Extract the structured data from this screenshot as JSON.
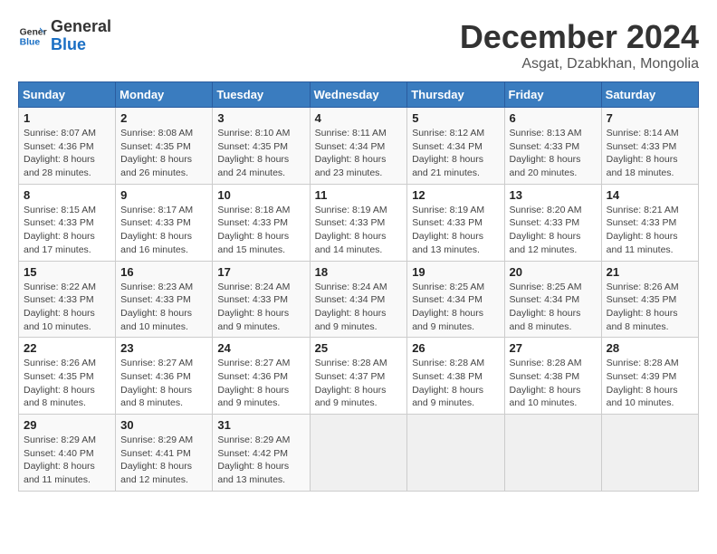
{
  "logo": {
    "line1": "General",
    "line2": "Blue"
  },
  "title": "December 2024",
  "subtitle": "Asgat, Dzabkhan, Mongolia",
  "days_of_week": [
    "Sunday",
    "Monday",
    "Tuesday",
    "Wednesday",
    "Thursday",
    "Friday",
    "Saturday"
  ],
  "weeks": [
    [
      {
        "day": "1",
        "sunrise": "8:07 AM",
        "sunset": "4:36 PM",
        "daylight": "8 hours and 28 minutes."
      },
      {
        "day": "2",
        "sunrise": "8:08 AM",
        "sunset": "4:35 PM",
        "daylight": "8 hours and 26 minutes."
      },
      {
        "day": "3",
        "sunrise": "8:10 AM",
        "sunset": "4:35 PM",
        "daylight": "8 hours and 24 minutes."
      },
      {
        "day": "4",
        "sunrise": "8:11 AM",
        "sunset": "4:34 PM",
        "daylight": "8 hours and 23 minutes."
      },
      {
        "day": "5",
        "sunrise": "8:12 AM",
        "sunset": "4:34 PM",
        "daylight": "8 hours and 21 minutes."
      },
      {
        "day": "6",
        "sunrise": "8:13 AM",
        "sunset": "4:33 PM",
        "daylight": "8 hours and 20 minutes."
      },
      {
        "day": "7",
        "sunrise": "8:14 AM",
        "sunset": "4:33 PM",
        "daylight": "8 hours and 18 minutes."
      }
    ],
    [
      {
        "day": "8",
        "sunrise": "8:15 AM",
        "sunset": "4:33 PM",
        "daylight": "8 hours and 17 minutes."
      },
      {
        "day": "9",
        "sunrise": "8:17 AM",
        "sunset": "4:33 PM",
        "daylight": "8 hours and 16 minutes."
      },
      {
        "day": "10",
        "sunrise": "8:18 AM",
        "sunset": "4:33 PM",
        "daylight": "8 hours and 15 minutes."
      },
      {
        "day": "11",
        "sunrise": "8:19 AM",
        "sunset": "4:33 PM",
        "daylight": "8 hours and 14 minutes."
      },
      {
        "day": "12",
        "sunrise": "8:19 AM",
        "sunset": "4:33 PM",
        "daylight": "8 hours and 13 minutes."
      },
      {
        "day": "13",
        "sunrise": "8:20 AM",
        "sunset": "4:33 PM",
        "daylight": "8 hours and 12 minutes."
      },
      {
        "day": "14",
        "sunrise": "8:21 AM",
        "sunset": "4:33 PM",
        "daylight": "8 hours and 11 minutes."
      }
    ],
    [
      {
        "day": "15",
        "sunrise": "8:22 AM",
        "sunset": "4:33 PM",
        "daylight": "8 hours and 10 minutes."
      },
      {
        "day": "16",
        "sunrise": "8:23 AM",
        "sunset": "4:33 PM",
        "daylight": "8 hours and 10 minutes."
      },
      {
        "day": "17",
        "sunrise": "8:24 AM",
        "sunset": "4:33 PM",
        "daylight": "8 hours and 9 minutes."
      },
      {
        "day": "18",
        "sunrise": "8:24 AM",
        "sunset": "4:34 PM",
        "daylight": "8 hours and 9 minutes."
      },
      {
        "day": "19",
        "sunrise": "8:25 AM",
        "sunset": "4:34 PM",
        "daylight": "8 hours and 9 minutes."
      },
      {
        "day": "20",
        "sunrise": "8:25 AM",
        "sunset": "4:34 PM",
        "daylight": "8 hours and 8 minutes."
      },
      {
        "day": "21",
        "sunrise": "8:26 AM",
        "sunset": "4:35 PM",
        "daylight": "8 hours and 8 minutes."
      }
    ],
    [
      {
        "day": "22",
        "sunrise": "8:26 AM",
        "sunset": "4:35 PM",
        "daylight": "8 hours and 8 minutes."
      },
      {
        "day": "23",
        "sunrise": "8:27 AM",
        "sunset": "4:36 PM",
        "daylight": "8 hours and 8 minutes."
      },
      {
        "day": "24",
        "sunrise": "8:27 AM",
        "sunset": "4:36 PM",
        "daylight": "8 hours and 9 minutes."
      },
      {
        "day": "25",
        "sunrise": "8:28 AM",
        "sunset": "4:37 PM",
        "daylight": "8 hours and 9 minutes."
      },
      {
        "day": "26",
        "sunrise": "8:28 AM",
        "sunset": "4:38 PM",
        "daylight": "8 hours and 9 minutes."
      },
      {
        "day": "27",
        "sunrise": "8:28 AM",
        "sunset": "4:38 PM",
        "daylight": "8 hours and 10 minutes."
      },
      {
        "day": "28",
        "sunrise": "8:28 AM",
        "sunset": "4:39 PM",
        "daylight": "8 hours and 10 minutes."
      }
    ],
    [
      {
        "day": "29",
        "sunrise": "8:29 AM",
        "sunset": "4:40 PM",
        "daylight": "8 hours and 11 minutes."
      },
      {
        "day": "30",
        "sunrise": "8:29 AM",
        "sunset": "4:41 PM",
        "daylight": "8 hours and 12 minutes."
      },
      {
        "day": "31",
        "sunrise": "8:29 AM",
        "sunset": "4:42 PM",
        "daylight": "8 hours and 13 minutes."
      },
      null,
      null,
      null,
      null
    ]
  ]
}
